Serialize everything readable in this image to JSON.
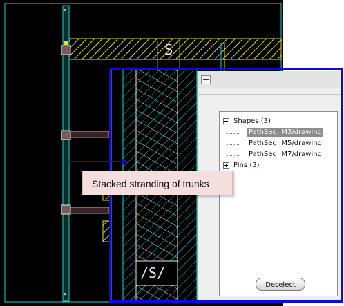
{
  "layout_view": {
    "net_label_s": "S",
    "bottom_label_s": "/S/"
  },
  "inspector": {
    "tree": {
      "shapes_label": "Shapes (3)",
      "shape_items": [
        "PathSeg: M3/drawing",
        "PathSeg: M5/drawing",
        "PathSeg: M7/drawing"
      ],
      "selected_index": 0,
      "pins_label": "Pins (3)"
    },
    "deselect_label": "Deselect"
  },
  "callout": {
    "text": "Stacked stranding of trunks"
  },
  "colors": {
    "layout_background": "#000000",
    "highlight_frame": "#0a0ae0",
    "trunk_cyan": "#19d2d2",
    "hatch_yellow": "#e6e61e",
    "stub_pink": "#c89aa0",
    "callout_fill": "#f7dede"
  }
}
